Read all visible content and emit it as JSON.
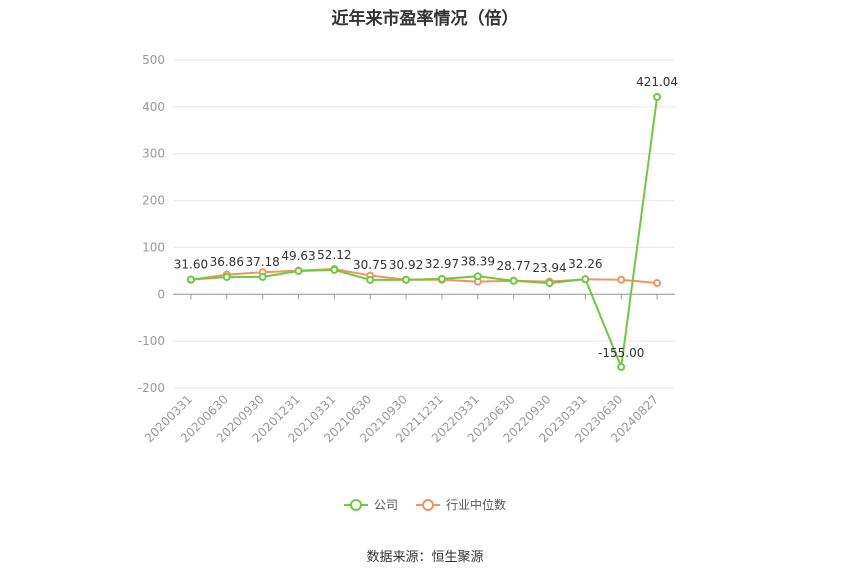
{
  "chart_data": {
    "type": "line",
    "title": "近年来市盈率情况（倍）",
    "categories": [
      "20200331",
      "20200630",
      "20200930",
      "20201231",
      "20210331",
      "20210630",
      "20210930",
      "20211231",
      "20220331",
      "20220630",
      "20220930",
      "20230331",
      "20230630",
      "20240827"
    ],
    "series": [
      {
        "name": "公司",
        "color": "#6dc93e",
        "values": [
          31.6,
          36.86,
          37.18,
          49.63,
          52.12,
          30.75,
          30.92,
          32.97,
          38.39,
          28.77,
          23.94,
          32.26,
          -155.0,
          421.04
        ],
        "labels": [
          "31.60",
          "36.86",
          "37.18",
          "49.63",
          "52.12",
          "30.75",
          "30.92",
          "32.97",
          "38.39",
          "28.77",
          "23.94",
          "32.26",
          "-155.00",
          "421.04"
        ]
      },
      {
        "name": "行业中位数",
        "color": "#f0955e",
        "values": [
          31.0,
          42.0,
          47.0,
          50.5,
          54.0,
          40.0,
          31.0,
          31.0,
          27.0,
          29.0,
          27.0,
          32.0,
          31.0,
          24.0
        ]
      }
    ],
    "yticks": [
      "500",
      "400",
      "300",
      "200",
      "100",
      "0",
      "-100",
      "-200"
    ],
    "ylim": [
      -200,
      500
    ],
    "grid": true,
    "legend": "bottom"
  },
  "source": "数据来源：恒生聚源"
}
